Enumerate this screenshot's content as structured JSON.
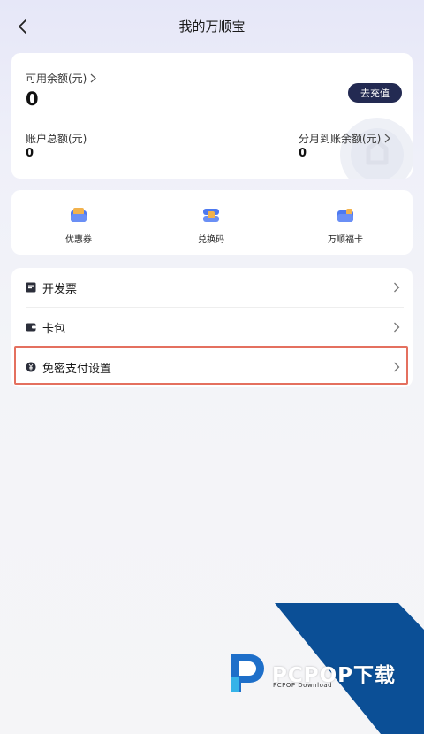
{
  "header": {
    "title": "我的万顺宝",
    "back_icon": "chevron-left-icon"
  },
  "balance": {
    "available_label": "可用余额(元)",
    "available_value": "0",
    "recharge_label": "去充值",
    "total_label": "账户总额(元)",
    "total_value": "0",
    "installment_label": "分月到账余额(元)",
    "installment_value": "0"
  },
  "quick_actions": [
    {
      "label": "优惠券",
      "icon": "coupon-icon"
    },
    {
      "label": "兑换码",
      "icon": "redeem-code-icon"
    },
    {
      "label": "万顺福卡",
      "icon": "gift-card-icon"
    }
  ],
  "menu": [
    {
      "label": "开发票",
      "icon": "invoice-icon"
    },
    {
      "label": "卡包",
      "icon": "wallet-icon"
    },
    {
      "label": "免密支付设置",
      "icon": "yuan-coin-icon",
      "highlighted": true
    }
  ],
  "colors": {
    "accent_button": "#232a52",
    "highlight_border": "#e4705f",
    "watermark_blue": "#0b4f96"
  },
  "watermark": {
    "brand": "PCPOP下载",
    "sub": "PCPOP Download"
  }
}
